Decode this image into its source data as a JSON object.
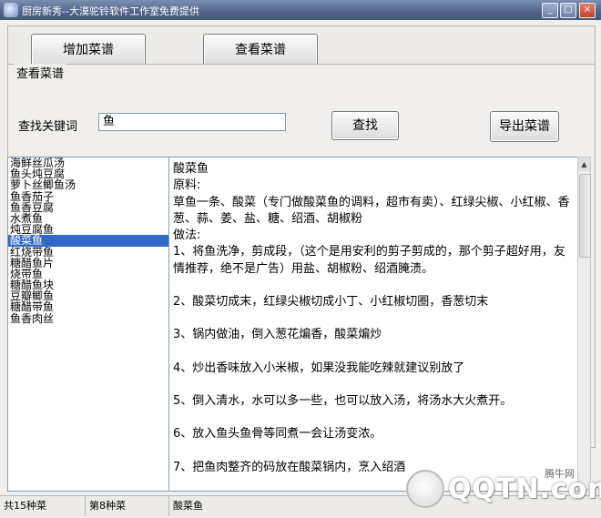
{
  "window": {
    "title": "厨房新秀--大漠驼铃软件工作室免费提供",
    "controls": {
      "minimize": "_",
      "maximize": "□",
      "close": "×"
    }
  },
  "toolbar": {
    "add_recipe": "增加菜谱",
    "view_recipe": "查看菜谱"
  },
  "panel": {
    "legend": "查看菜谱",
    "search_label": "查找关键词",
    "search_value": "鱼",
    "search_button": "查找",
    "export_button": "导出菜谱"
  },
  "recipe_list": {
    "items": [
      "海鲜丝瓜汤",
      "鱼头炖豆腐",
      "萝卜丝鲫鱼汤",
      "鱼香茄子",
      "鱼香豆腐",
      "水煮鱼",
      "炖豆腐鱼",
      "酸菜鱼",
      "红烧带鱼",
      "糖醋鱼片",
      "烧带鱼",
      "糖醋鱼块",
      "豆瓣鲫鱼",
      "糖醋带鱼",
      "鱼香肉丝"
    ],
    "selected_index": 7
  },
  "detail": {
    "title": "酸菜鱼",
    "ingredients_label": "原料:",
    "ingredients": "草鱼一条、酸菜（专门做酸菜鱼的调料，超市有卖）、红绿尖椒、小红椒、香葱、蒜、姜、盐、糖、绍酒、胡椒粉",
    "method_label": "做法:",
    "steps": [
      "1、将鱼洗净，剪成段，（这个是用安利的剪子剪成的，那个剪子超好用，友情推荐，绝不是广告）用盐、胡椒粉、绍酒腌渍。",
      "2、酸菜切成末，红绿尖椒切成小丁、小红椒切圈，香葱切末",
      "3、锅内做油，倒入葱花煸香，酸菜煸炒",
      "4、炒出香味放入小米椒，如果没我能吃辣就建议别放了",
      "5、倒入清水，水可以多一些，也可以放入汤，将汤水大火煮开。",
      "6、放入鱼头鱼骨等同煮一会让汤变浓。",
      "7、把鱼肉整齐的码放在酸菜锅内，烹入绍酒"
    ]
  },
  "status_bar": {
    "total": "共15种菜",
    "current": "第8种菜",
    "name": "酸菜鱼"
  },
  "watermark": {
    "text": "QQTN.com",
    "small": "腾牛网"
  }
}
